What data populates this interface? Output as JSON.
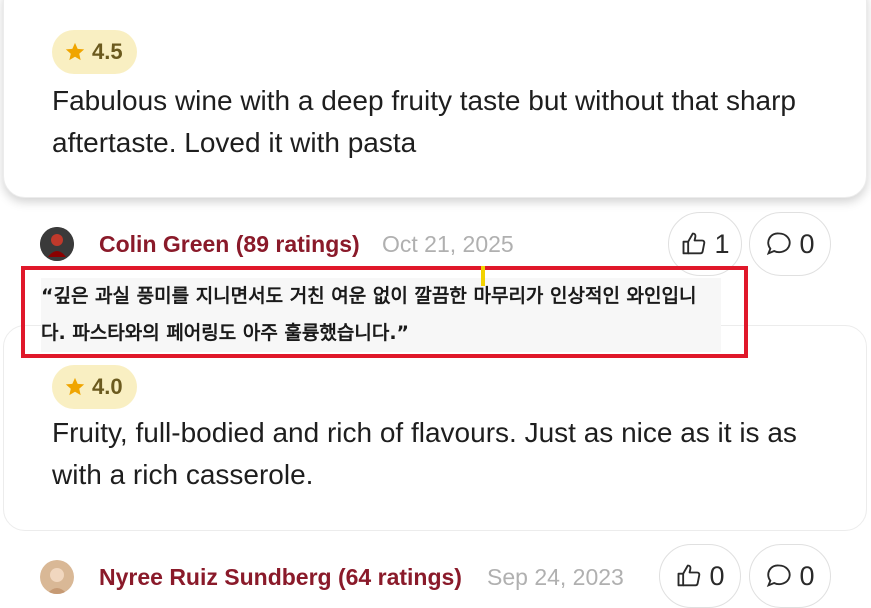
{
  "reviews": [
    {
      "rating": "4.5",
      "text": "Fabulous wine with a deep fruity taste but without that sharp aftertaste. Loved it with pasta"
    },
    {
      "rating": "4.0",
      "text": "Fruity, full-bodied and rich of flavours. Just as nice as it is as with a rich casserole."
    }
  ],
  "comments": [
    {
      "author": "Colin Green (89 ratings)",
      "date": "Oct 21, 2025",
      "likes": "1",
      "replies": "0",
      "translation": "“깊은 과실 풍미를 지니면서도 거친 여운 없이 깔끔한 마무리가 인상적인 와인입니다. 파스타와의 페어링도 아주 훌륭했습니다.”"
    },
    {
      "author": "Nyree Ruiz Sundberg (64 ratings)",
      "date": "Sep 24, 2023",
      "likes": "0",
      "replies": "0"
    }
  ],
  "colors": {
    "author": "#8a1a2a",
    "badge_bg": "#f9efc2",
    "star": "#f0a500",
    "highlight_border": "#e0182a"
  },
  "icons": [
    "star-icon",
    "thumbs-up-icon",
    "comment-icon"
  ]
}
